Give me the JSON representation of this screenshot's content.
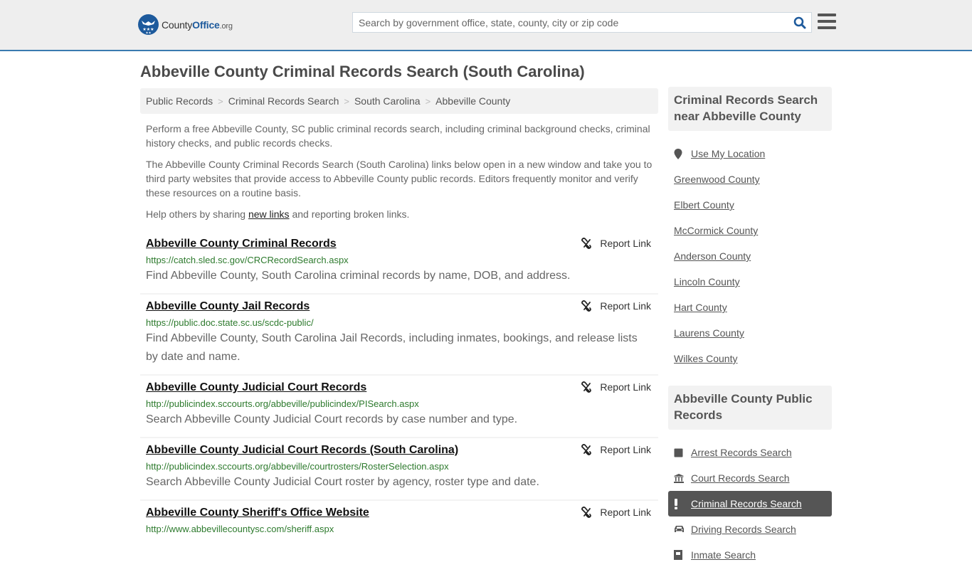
{
  "header": {
    "logo": {
      "brand_main": "County",
      "brand_accent": "Office",
      "brand_tld": ".org"
    },
    "search": {
      "placeholder": "Search by government office, state, county, city or zip code",
      "value": ""
    },
    "colors": {
      "brand_blue": "#1d5a9c",
      "header_border": "#3a7bb0",
      "header_bg": "#eeeeee"
    }
  },
  "page_title": "Abbeville County Criminal Records Search (South Carolina)",
  "breadcrumb": [
    {
      "label": "Public Records"
    },
    {
      "label": "Criminal Records Search"
    },
    {
      "label": "South Carolina"
    },
    {
      "label": "Abbeville County"
    }
  ],
  "intro": {
    "p1": "Perform a free Abbeville County, SC public criminal records search, including criminal background checks, criminal history checks, and public records checks.",
    "p2": "The Abbeville County Criminal Records Search (South Carolina) links below open in a new window and take you to third party websites that provide access to Abbeville County public records. Editors frequently monitor and verify these resources on a routine basis.",
    "p3_before": "Help others by sharing ",
    "p3_link": "new links",
    "p3_after": " and reporting broken links."
  },
  "report_label": "Report Link",
  "results": [
    {
      "title": "Abbeville County Criminal Records",
      "url": "https://catch.sled.sc.gov/CRCRecordSearch.aspx",
      "desc": "Find Abbeville County, South Carolina criminal records by name, DOB, and address."
    },
    {
      "title": "Abbeville County Jail Records",
      "url": "https://public.doc.state.sc.us/scdc-public/",
      "desc": "Find Abbeville County, South Carolina Jail Records, including inmates, bookings, and release lists by date and name."
    },
    {
      "title": "Abbeville County Judicial Court Records",
      "url": "http://publicindex.sccourts.org/abbeville/publicindex/PISearch.aspx",
      "desc": "Search Abbeville County Judicial Court records by case number and type."
    },
    {
      "title": "Abbeville County Judicial Court Records (South Carolina)",
      "url": "http://publicindex.sccourts.org/abbeville/courtrosters/RosterSelection.aspx",
      "desc": "Search Abbeville County Judicial Court roster by agency, roster type and date."
    },
    {
      "title": "Abbeville County Sheriff's Office Website",
      "url": "http://www.abbevillecountysc.com/sheriff.aspx",
      "desc": ""
    }
  ],
  "sidebar": {
    "nearby": {
      "heading": "Criminal Records Search near Abbeville County",
      "use_location": "Use My Location",
      "items": [
        {
          "label": "Greenwood County"
        },
        {
          "label": "Elbert County"
        },
        {
          "label": "McCormick County"
        },
        {
          "label": "Anderson County"
        },
        {
          "label": "Lincoln County"
        },
        {
          "label": "Hart County"
        },
        {
          "label": "Laurens County"
        },
        {
          "label": "Wilkes County"
        }
      ]
    },
    "public_records": {
      "heading": "Abbeville County Public Records",
      "items": [
        {
          "label": "Arrest Records Search",
          "icon": "square-icon",
          "active": false
        },
        {
          "label": "Court Records Search",
          "icon": "courthouse-icon",
          "active": false
        },
        {
          "label": "Criminal Records Search",
          "icon": "exclamation-icon",
          "active": true
        },
        {
          "label": "Driving Records Search",
          "icon": "car-icon",
          "active": false
        },
        {
          "label": "Inmate Search",
          "icon": "jail-icon",
          "active": false
        }
      ]
    }
  }
}
